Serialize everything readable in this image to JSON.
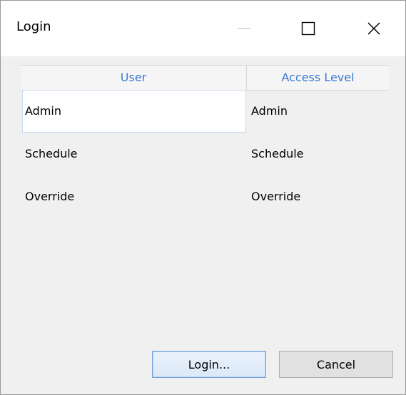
{
  "window": {
    "title": "Login",
    "controls": {
      "minimize": "minimize-icon",
      "maximize": "maximize-icon",
      "close": "close-icon"
    }
  },
  "grid": {
    "columns": [
      "User",
      "Access Level"
    ],
    "rows": [
      {
        "user": "Admin",
        "access_level": "Admin",
        "selected": true
      },
      {
        "user": "Schedule",
        "access_level": "Schedule",
        "selected": false
      },
      {
        "user": "Override",
        "access_level": "Override",
        "selected": false
      }
    ]
  },
  "buttons": {
    "login_label": "Login...",
    "cancel_label": "Cancel"
  },
  "colors": {
    "header_text": "#3a78d3",
    "selection_border": "#c8d8ee",
    "primary_button_border": "#6f9fd9"
  }
}
